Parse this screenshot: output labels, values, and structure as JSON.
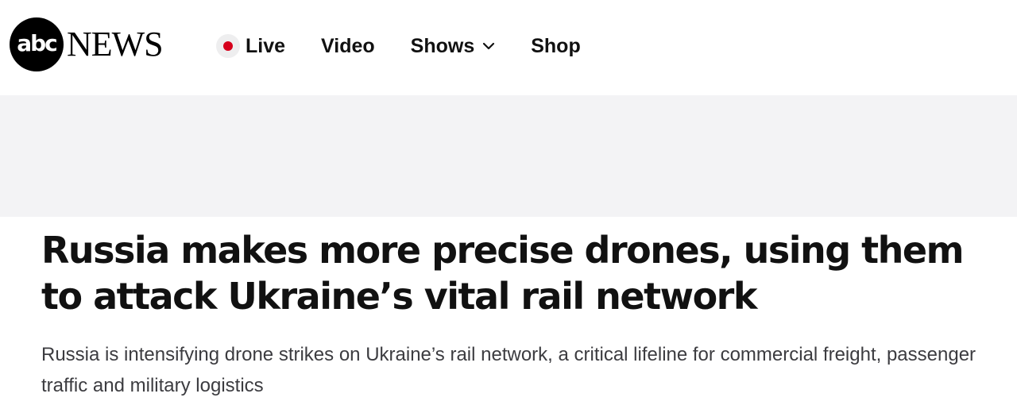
{
  "header": {
    "logo": {
      "mark_text": "abc",
      "wordmark": "NEWS"
    },
    "nav": [
      {
        "label": "Live",
        "icon": "live-dot-icon"
      },
      {
        "label": "Video"
      },
      {
        "label": "Shows",
        "icon": "chevron-down-icon"
      },
      {
        "label": "Shop"
      }
    ]
  },
  "article": {
    "headline": "Russia makes more precise drones, using them to attack Ukraine’s vital rail network",
    "subheadline": "Russia is intensifying drone strikes on Ukraine’s rail network, a critical lifeline for commercial freight, passenger traffic and military logistics"
  },
  "colors": {
    "live_dot": "#d6001c",
    "ad_band": "#f3f3f5",
    "headline": "#111111",
    "subheadline": "#3c3c40"
  }
}
